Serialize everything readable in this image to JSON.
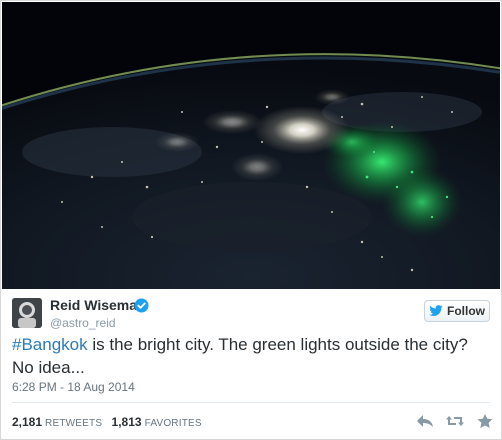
{
  "tweet": {
    "author_name": "Reid Wiseman",
    "author_handle": "@astro_reid",
    "verified": true,
    "hashtag": "#Bangkok",
    "text_rest": " is the bright city. The green lights outside the city? No idea...",
    "timestamp": "6:28 PM - 18 Aug 2014",
    "retweets_count": "2,181",
    "retweets_label": "RETWEETS",
    "favorites_count": "1,813",
    "favorites_label": "FAVORITES"
  },
  "follow_button": {
    "label": "Follow"
  },
  "icons": {
    "verified": "verified-badge-icon",
    "follow": "bird-icon",
    "reply": "reply-icon",
    "retweet": "retweet-icon",
    "favorite": "star-icon"
  },
  "colors": {
    "link": "#2b7bb9",
    "verified": "#1da1f2",
    "muted": "#66757f",
    "text": "#292f33"
  }
}
